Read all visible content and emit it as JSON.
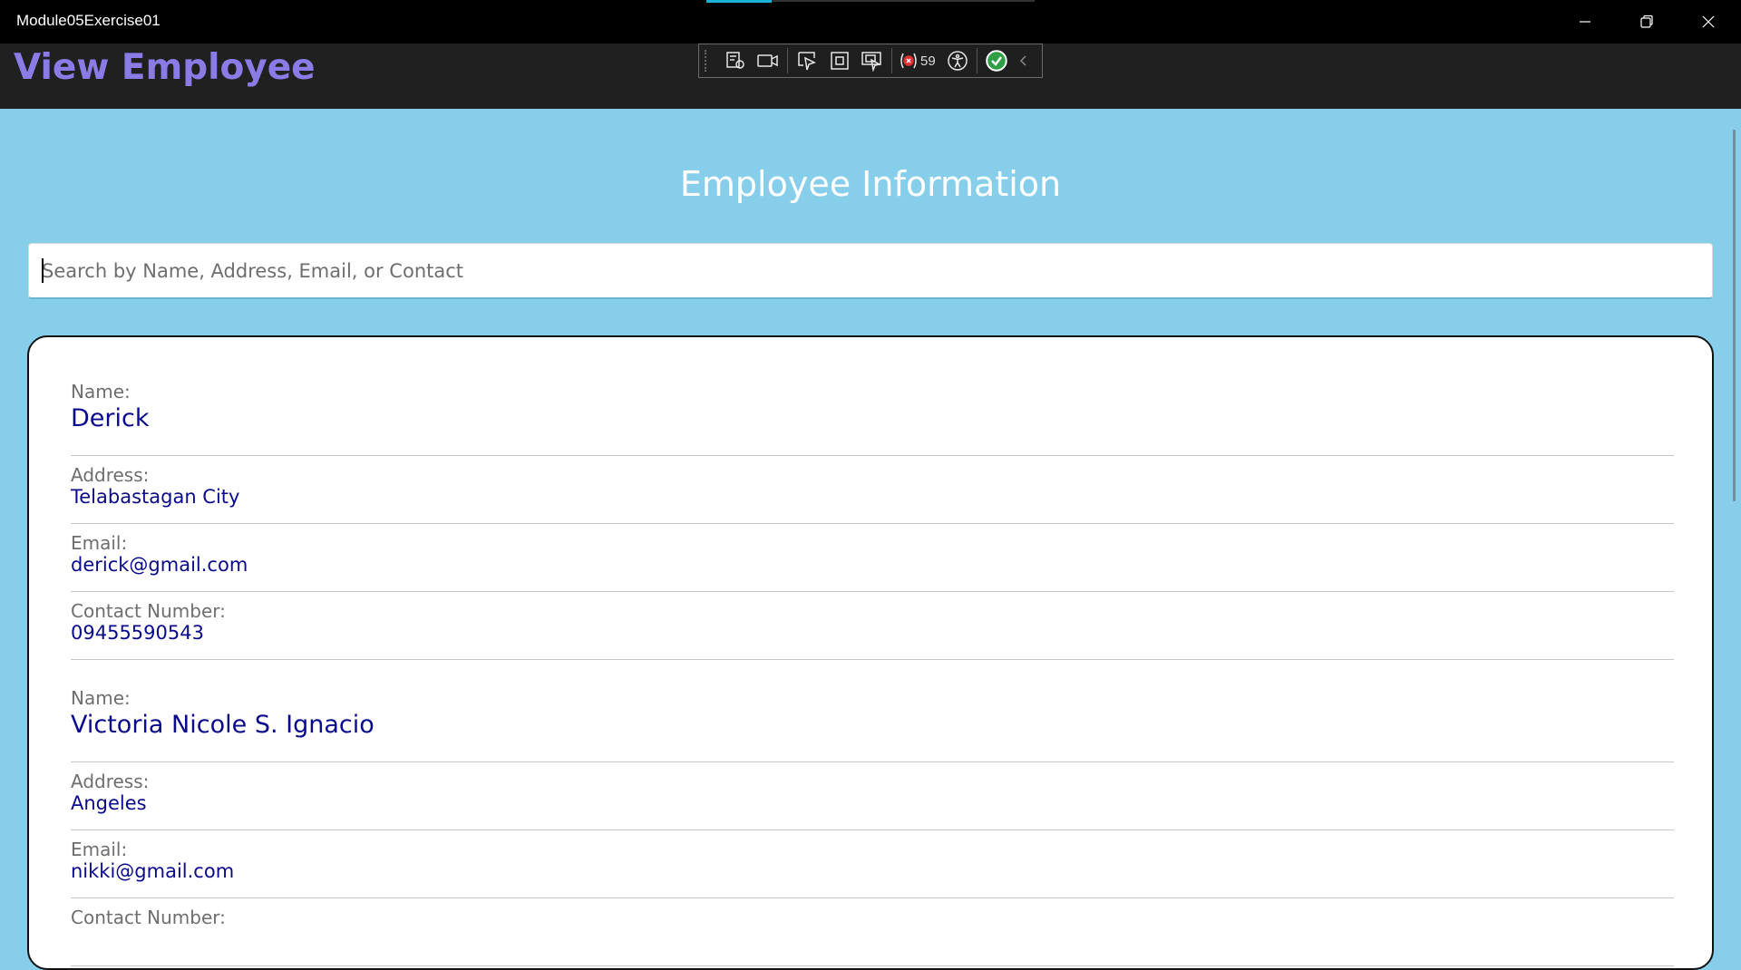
{
  "window": {
    "title": "Module05Exercise01",
    "controls": [
      "minimize-icon",
      "restore-icon",
      "close-icon"
    ]
  },
  "header": {
    "title": "View Employee",
    "title_color": "#8a7be6",
    "background": "#202020"
  },
  "debug_toolbar": {
    "items": [
      "live-visual-tree-icon",
      "record-icon",
      "select-element-icon",
      "display-layout-adorners-icon",
      "track-focus-icon",
      "hot-reload-icon",
      "accessibility-icon",
      "checkmark-icon",
      "collapse-chevron-icon"
    ],
    "binding_failures": "59"
  },
  "main": {
    "background": "#87ceeb",
    "section_title": "Employee Information",
    "search": {
      "placeholder": "Search by Name, Address, Email, or Contact",
      "value": ""
    },
    "labels": {
      "name": "Name:",
      "address": "Address:",
      "email": "Email:",
      "contact": "Contact Number:"
    },
    "employees": [
      {
        "name": "Derick",
        "address": "Telabastagan City",
        "email": "derick@gmail.com",
        "contact": "09455590543"
      },
      {
        "name": "Victoria Nicole S. Ignacio",
        "address": "Angeles",
        "email": "nikki@gmail.com",
        "contact": ""
      }
    ],
    "value_color": "#0a0a8c"
  }
}
